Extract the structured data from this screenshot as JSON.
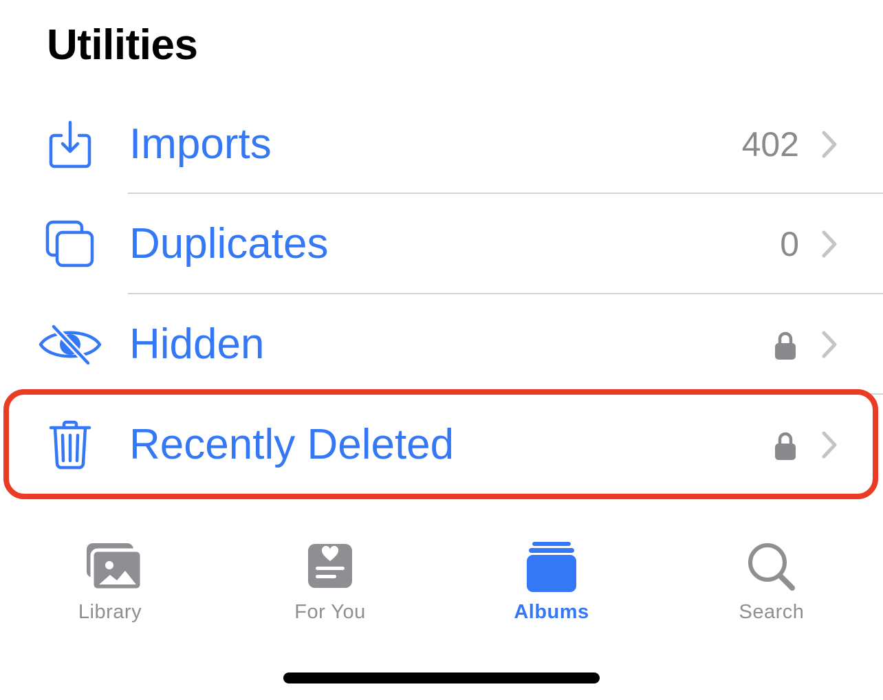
{
  "section": {
    "title": "Utilities"
  },
  "rows": [
    {
      "label": "Imports",
      "count": "402",
      "icon": "import-tray-icon",
      "accessory": "count"
    },
    {
      "label": "Duplicates",
      "count": "0",
      "icon": "duplicates-icon",
      "accessory": "count"
    },
    {
      "label": "Hidden",
      "icon": "eye-slash-icon",
      "accessory": "lock"
    },
    {
      "label": "Recently Deleted",
      "icon": "trash-icon",
      "accessory": "lock",
      "highlighted": true
    }
  ],
  "tabbar": {
    "tabs": [
      {
        "label": "Library",
        "icon": "photo-stack-icon",
        "active": false
      },
      {
        "label": "For You",
        "icon": "memories-heart-icon",
        "active": false
      },
      {
        "label": "Albums",
        "icon": "albums-stack-icon",
        "active": true
      },
      {
        "label": "Search",
        "icon": "magnifier-icon",
        "active": false
      }
    ]
  },
  "colors": {
    "accent": "#3478f6",
    "secondary_text": "#8a8a8e",
    "tab_inactive": "#8e8e93",
    "highlight": "#ea3b24",
    "divider": "#d3d3d6",
    "chevron": "#c4c4c7"
  }
}
